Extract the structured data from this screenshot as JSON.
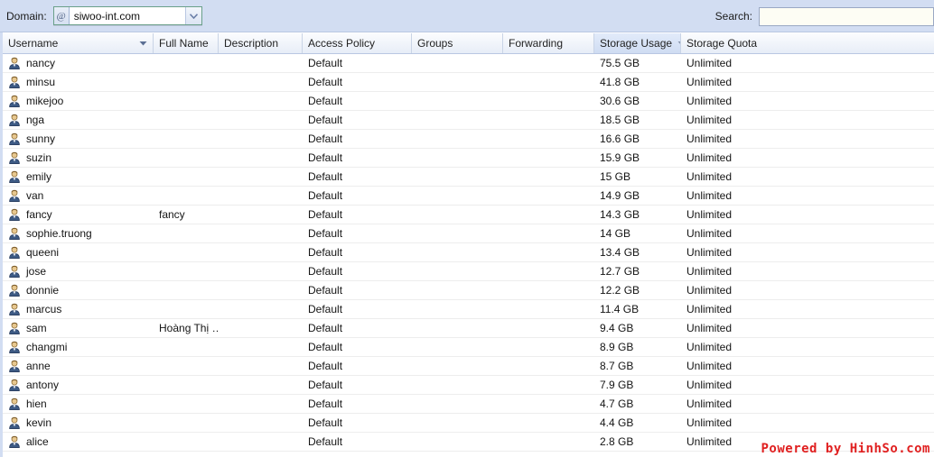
{
  "toolbar": {
    "domain_label": "Domain:",
    "domain_prefix_icon": "at-sign-icon",
    "domain_value": "siwoo-int.com",
    "search_label": "Search:",
    "search_value": "",
    "search_placeholder": ""
  },
  "grid": {
    "columns": [
      {
        "key": "username",
        "label": "Username",
        "sorted": false,
        "sort_dir": "desc"
      },
      {
        "key": "full_name",
        "label": "Full Name",
        "sorted": false
      },
      {
        "key": "description",
        "label": "Description",
        "sorted": false
      },
      {
        "key": "access_policy",
        "label": "Access Policy",
        "sorted": false
      },
      {
        "key": "groups",
        "label": "Groups",
        "sorted": false
      },
      {
        "key": "forwarding",
        "label": "Forwarding",
        "sorted": false
      },
      {
        "key": "storage_usage",
        "label": "Storage Usage",
        "sorted": true,
        "sort_dir": "desc"
      },
      {
        "key": "storage_quota",
        "label": "Storage Quota",
        "sorted": false
      }
    ],
    "rows": [
      {
        "icon": "user-icon",
        "username": "nancy",
        "full_name": "",
        "description": "",
        "access_policy": "Default",
        "groups": "",
        "forwarding": "",
        "storage_usage": "75.5 GB",
        "storage_quota": "Unlimited"
      },
      {
        "icon": "user-icon",
        "username": "minsu",
        "full_name": "",
        "description": "",
        "access_policy": "Default",
        "groups": "",
        "forwarding": "",
        "storage_usage": "41.8 GB",
        "storage_quota": "Unlimited"
      },
      {
        "icon": "user-icon",
        "username": "mikejoo",
        "full_name": "",
        "description": "",
        "access_policy": "Default",
        "groups": "",
        "forwarding": "",
        "storage_usage": "30.6 GB",
        "storage_quota": "Unlimited"
      },
      {
        "icon": "user-icon",
        "username": "nga",
        "full_name": "",
        "description": "",
        "access_policy": "Default",
        "groups": "",
        "forwarding": "",
        "storage_usage": "18.5 GB",
        "storage_quota": "Unlimited"
      },
      {
        "icon": "user-icon",
        "username": "sunny",
        "full_name": "",
        "description": "",
        "access_policy": "Default",
        "groups": "",
        "forwarding": "",
        "storage_usage": "16.6 GB",
        "storage_quota": "Unlimited"
      },
      {
        "icon": "user-icon",
        "username": "suzin",
        "full_name": "",
        "description": "",
        "access_policy": "Default",
        "groups": "",
        "forwarding": "",
        "storage_usage": "15.9 GB",
        "storage_quota": "Unlimited"
      },
      {
        "icon": "user-icon",
        "username": "emily",
        "full_name": "",
        "description": "",
        "access_policy": "Default",
        "groups": "",
        "forwarding": "",
        "storage_usage": "15 GB",
        "storage_quota": "Unlimited"
      },
      {
        "icon": "user-icon",
        "username": "van",
        "full_name": "",
        "description": "",
        "access_policy": "Default",
        "groups": "",
        "forwarding": "",
        "storage_usage": "14.9 GB",
        "storage_quota": "Unlimited"
      },
      {
        "icon": "user-icon",
        "username": "fancy",
        "full_name": "fancy",
        "description": "",
        "access_policy": "Default",
        "groups": "",
        "forwarding": "",
        "storage_usage": "14.3 GB",
        "storage_quota": "Unlimited"
      },
      {
        "icon": "user-icon",
        "username": "sophie.truong",
        "full_name": "",
        "description": "",
        "access_policy": "Default",
        "groups": "",
        "forwarding": "",
        "storage_usage": "14 GB",
        "storage_quota": "Unlimited"
      },
      {
        "icon": "user-icon",
        "username": "queeni",
        "full_name": "",
        "description": "",
        "access_policy": "Default",
        "groups": "",
        "forwarding": "",
        "storage_usage": "13.4 GB",
        "storage_quota": "Unlimited"
      },
      {
        "icon": "user-icon",
        "username": "jose",
        "full_name": "",
        "description": "",
        "access_policy": "Default",
        "groups": "",
        "forwarding": "",
        "storage_usage": "12.7 GB",
        "storage_quota": "Unlimited"
      },
      {
        "icon": "user-icon",
        "username": "donnie",
        "full_name": "",
        "description": "",
        "access_policy": "Default",
        "groups": "",
        "forwarding": "",
        "storage_usage": "12.2 GB",
        "storage_quota": "Unlimited"
      },
      {
        "icon": "user-icon",
        "username": "marcus",
        "full_name": "",
        "description": "",
        "access_policy": "Default",
        "groups": "",
        "forwarding": "",
        "storage_usage": "11.4 GB",
        "storage_quota": "Unlimited"
      },
      {
        "icon": "user-icon",
        "username": "sam",
        "full_name": "Hoàng Thị …",
        "description": "",
        "access_policy": "Default",
        "groups": "",
        "forwarding": "",
        "storage_usage": "9.4 GB",
        "storage_quota": "Unlimited"
      },
      {
        "icon": "user-icon",
        "username": "changmi",
        "full_name": "",
        "description": "",
        "access_policy": "Default",
        "groups": "",
        "forwarding": "",
        "storage_usage": "8.9 GB",
        "storage_quota": "Unlimited"
      },
      {
        "icon": "user-icon",
        "username": "anne",
        "full_name": "",
        "description": "",
        "access_policy": "Default",
        "groups": "",
        "forwarding": "",
        "storage_usage": "8.7 GB",
        "storage_quota": "Unlimited"
      },
      {
        "icon": "user-icon",
        "username": "antony",
        "full_name": "",
        "description": "",
        "access_policy": "Default",
        "groups": "",
        "forwarding": "",
        "storage_usage": "7.9 GB",
        "storage_quota": "Unlimited"
      },
      {
        "icon": "user-icon",
        "username": "hien",
        "full_name": "",
        "description": "",
        "access_policy": "Default",
        "groups": "",
        "forwarding": "",
        "storage_usage": "4.7 GB",
        "storage_quota": "Unlimited"
      },
      {
        "icon": "user-icon",
        "username": "kevin",
        "full_name": "",
        "description": "",
        "access_policy": "Default",
        "groups": "",
        "forwarding": "",
        "storage_usage": "4.4 GB",
        "storage_quota": "Unlimited"
      },
      {
        "icon": "user-icon",
        "username": "alice",
        "full_name": "",
        "description": "",
        "access_policy": "Default",
        "groups": "",
        "forwarding": "",
        "storage_usage": "2.8 GB",
        "storage_quota": "Unlimited"
      }
    ]
  },
  "watermark": {
    "text": "Powered by HinhSo.com",
    "color": "#e02020"
  },
  "colors": {
    "toolbar_bg": "#d2ddf2",
    "header_bg": "#e7edf7",
    "sorted_header_bg": "#cfdcf2",
    "row_bg": "#ffffff",
    "row_border": "#ededed",
    "combo_border": "#6aa08a"
  }
}
